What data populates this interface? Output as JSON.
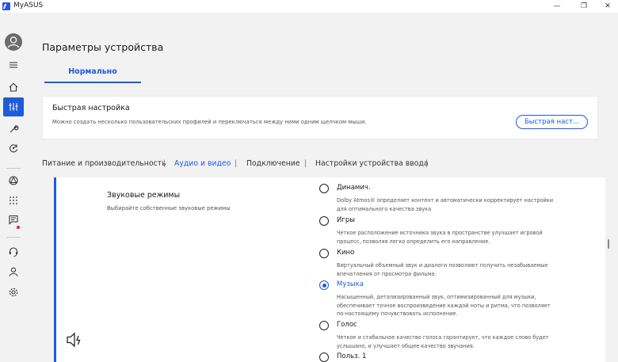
{
  "window": {
    "title": "MyASUS",
    "minimize": "—",
    "maximize": "❐",
    "close": "✕"
  },
  "sidebar": {
    "items": [
      {
        "name": "menu-icon"
      },
      {
        "name": "home-icon"
      },
      {
        "name": "device-settings-icon",
        "active": true
      },
      {
        "name": "wrench-icon"
      },
      {
        "name": "update-icon"
      },
      {
        "name": "link-icon"
      },
      {
        "name": "apps-icon"
      },
      {
        "name": "message-icon",
        "badge": true
      },
      {
        "name": "support-icon"
      },
      {
        "name": "user-icon"
      },
      {
        "name": "gear-icon"
      }
    ],
    "accent": "#1e5bd8"
  },
  "page": {
    "title": "Параметры устройства",
    "profile_tab": "Нормально"
  },
  "quick_setup": {
    "title": "Быстрая настройка",
    "description": "Можно создать несколько пользовательских профилей и переключаться между ними одним щелчком мыши.",
    "button": "Быстрая наст..."
  },
  "tabs": {
    "items": [
      "Питание и производительность",
      "Аудио и видео",
      "Подключение",
      "Настройки устройства ввода"
    ],
    "active": "Аудио и видео",
    "separator": "|"
  },
  "sound_modes": {
    "title": "Звуковые режимы",
    "description": "Выбирайте собственные звуковые режимы",
    "options": [
      {
        "label": "Динамич.",
        "description": "Dolby Atmos® определяет контент и автоматически корректирует настройки для оптимального качества звука",
        "selected": false
      },
      {
        "label": "Игры",
        "description": "Четкое расположение источника звука в пространстве улучшает игровой процесс, позволяя легко определить его направление.",
        "selected": false
      },
      {
        "label": "Кино",
        "description": "Виртуальный объемный звук и диалоги позволяют получить незабываемые впечатления от просмотра фильма.",
        "selected": false
      },
      {
        "label": "Музыка",
        "description": "Насыщенный, детализированный звук, оптимизированный для музыки, обеспечивает точное воспроизведение каждой ноты и ритма, что позволяет по-настоящему почувствовать исполнение.",
        "selected": true
      },
      {
        "label": "Голос",
        "description": "Четкое и стабильное качество голоса гарантирует, что каждое слово будет услышано, и улучшает общее качество звучания.",
        "selected": false
      },
      {
        "label": "Польз. 1",
        "description": "",
        "selected": false
      }
    ]
  }
}
